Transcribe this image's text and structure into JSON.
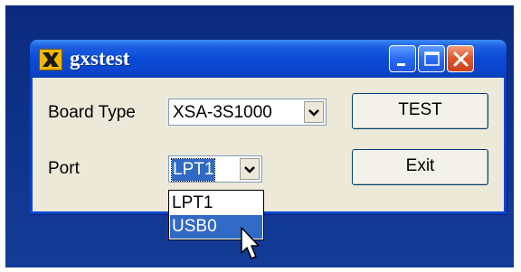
{
  "window": {
    "title": "gxstest",
    "controls": {
      "minimize": "minimize",
      "maximize": "maximize",
      "close": "close"
    }
  },
  "form": {
    "board_type_label": "Board Type",
    "board_type_value": "XSA-3S1000",
    "port_label": "Port",
    "port_value": "LPT1",
    "port_options": [
      "LPT1",
      "USB0"
    ],
    "port_highlighted": "USB0"
  },
  "buttons": {
    "test": "TEST",
    "exit": "Exit"
  },
  "colors": {
    "titlebar": "#0a4ad6",
    "window_bg": "#ece9d8",
    "selection": "#316ac5",
    "close_button": "#e2582f",
    "desktop": "#0c2f87"
  },
  "icons": [
    "app-icon",
    "minimize-icon",
    "maximize-icon",
    "close-icon",
    "chevron-down-icon",
    "mouse-pointer-icon"
  ]
}
